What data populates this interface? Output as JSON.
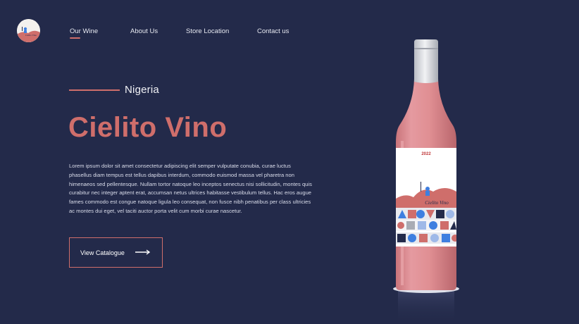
{
  "logo": {
    "text": "Cielito Vino",
    "icon": "winery-logo-icon"
  },
  "nav": {
    "items": [
      {
        "label": "Our Wine",
        "active": true
      },
      {
        "label": "About Us",
        "active": false
      },
      {
        "label": "Store Location",
        "active": false
      },
      {
        "label": "Contact us",
        "active": false
      }
    ]
  },
  "hero": {
    "subtitle": "Nigeria",
    "title": "Cielito Vino",
    "description": "Lorem ipsum dolor sit amet consectetur adipiscing elit semper vulputate conubia, curae luctus phasellus diam tempus est tellus dapibus interdum, commodo euismod massa vel pharetra non himenaeos sed pellentesque. Nullam tortor natoque leo inceptos senectus nisi sollicitudin, montes quis curabitur nec integer aptent erat, accumsan netus ultrices habitasse vestibulum tellus. Hac eros augue fames commodo est congue natoque ligula leo consequat, non fusce nibh penatibus per class ultricies ac montes dui eget, vel taciti auctor porta velit cum morbi curae nascetur.",
    "cta_label": "View Catalogue",
    "cta_icon": "arrow-right-icon"
  },
  "bottle": {
    "year": "2022",
    "brand": "Cielito Vino"
  },
  "colors": {
    "background": "#232a4a",
    "accent": "#cf6e6b",
    "bottle": "#e08f93",
    "tile_blue": "#3e7fe0"
  }
}
